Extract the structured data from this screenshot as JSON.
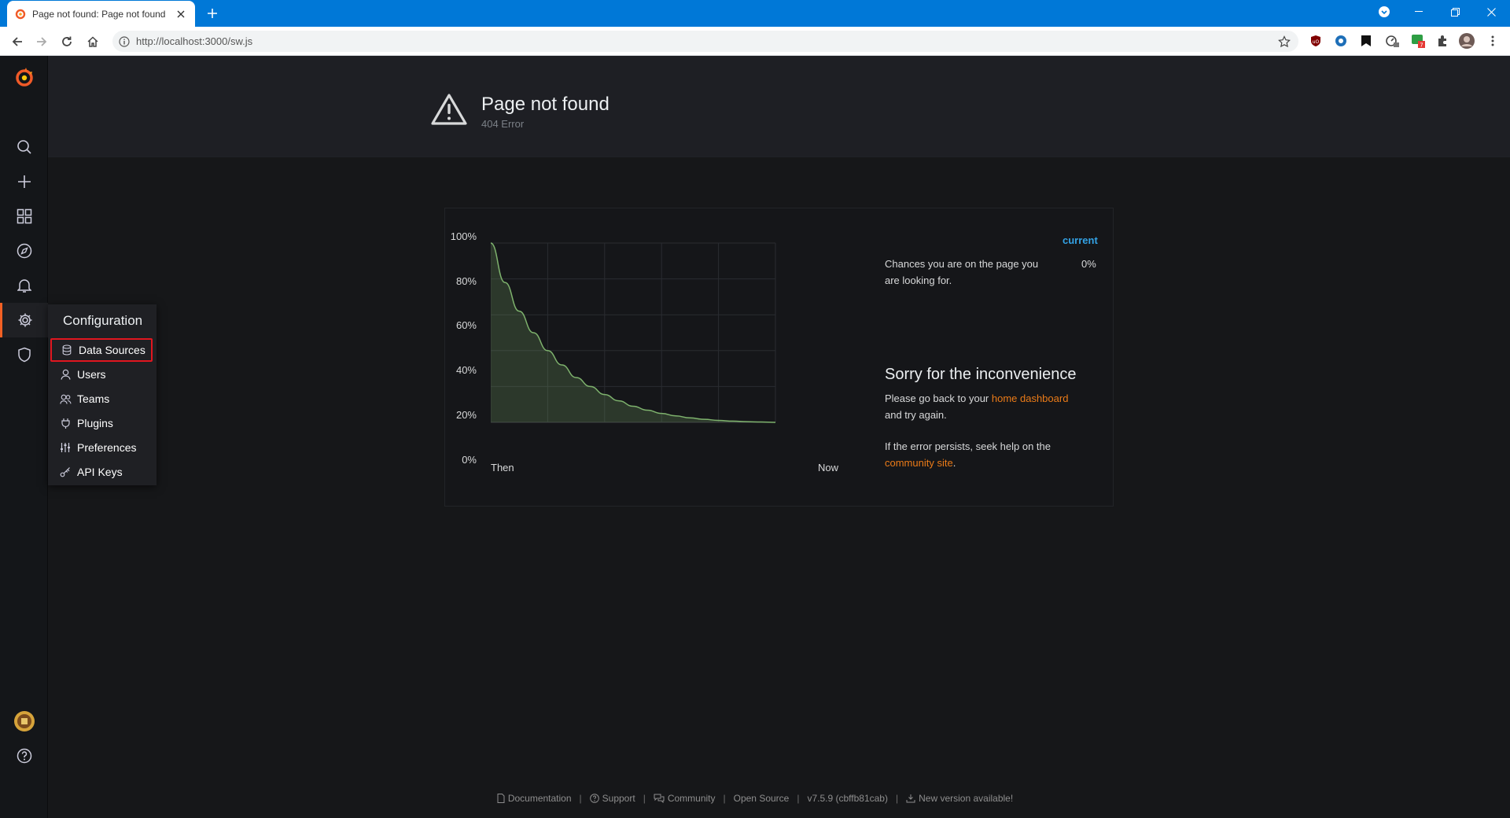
{
  "browser": {
    "tab_title": "Page not found: Page not found",
    "url": "http://localhost:3000/sw.js",
    "accent": "#0078d7"
  },
  "sidemenu": {
    "items": [
      "grafana-logo",
      "search-icon",
      "plus-icon",
      "dashboards-icon",
      "explore-icon",
      "alerting-icon",
      "gear-icon",
      "shield-icon",
      "avatar",
      "help-icon"
    ],
    "active": "Configuration",
    "active_color": "#f26024"
  },
  "config_menu": {
    "header": "Configuration",
    "items": [
      {
        "label": "Data Sources",
        "icon": "database-icon",
        "highlighted": true
      },
      {
        "label": "Users",
        "icon": "user-icon"
      },
      {
        "label": "Teams",
        "icon": "users-icon"
      },
      {
        "label": "Plugins",
        "icon": "plug-icon"
      },
      {
        "label": "Preferences",
        "icon": "sliders-icon"
      },
      {
        "label": "API Keys",
        "icon": "key-icon"
      }
    ]
  },
  "page_header": {
    "title": "Page not found",
    "subtitle": "404 Error"
  },
  "chart_data": {
    "type": "area",
    "x_labels": [
      "Then",
      "Now"
    ],
    "y_ticks": [
      "100%",
      "80%",
      "60%",
      "40%",
      "20%",
      "0%"
    ],
    "ylim": [
      0,
      100
    ],
    "series": [
      {
        "values": [
          100,
          78,
          62,
          50,
          40,
          32,
          25,
          20,
          15.5,
          12,
          9,
          6.8,
          5,
          3.6,
          2.5,
          1.7,
          1.1,
          0.7,
          0.4,
          0.2,
          0
        ]
      }
    ],
    "line_color": "#7eb26d",
    "legend_header": "current",
    "legend_series": "Chances you are on the page you are looking for.",
    "legend_value": "0%"
  },
  "message": {
    "heading": "Sorry for the inconvenience",
    "line1_pre": "Please go back to your ",
    "line1_link": "home dashboard",
    "line1_post": "and try again.",
    "line2_pre": "If the error persists, seek help on the",
    "line2_link": "community site",
    "line2_post": "."
  },
  "footer": {
    "documentation": "Documentation",
    "support": "Support",
    "community": "Community",
    "open_source": "Open Source",
    "version": "v7.5.9 (cbffb81cab)",
    "new_version": "New version available!"
  }
}
